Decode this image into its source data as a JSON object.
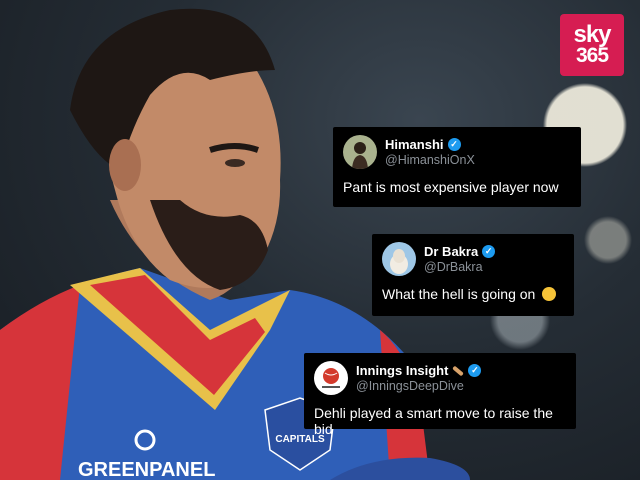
{
  "brand": {
    "logo_line1": "sky",
    "logo_line2": "365"
  },
  "jersey": {
    "sponsor": "GREENPANEL",
    "badge": "CAPITALS"
  },
  "tweets": [
    {
      "name": "Himanshi",
      "handle": "@HimanshiOnX",
      "text": "Pant is most expensive player now",
      "avatar_icon": "profile-photo-woman",
      "verified": true
    },
    {
      "name": "Dr Bakra",
      "handle": "@DrBakra",
      "text": "What the hell is going on",
      "avatar_icon": "goat-photo",
      "verified": true,
      "emoji": "crying-face-emoji"
    },
    {
      "name": "Innings Insight",
      "handle": "@InningsDeepDive",
      "text": "Dehli played a smart move to raise the bid",
      "avatar_icon": "cricket-ball-logo",
      "verified": true,
      "name_emoji": "cricket-bat-emoji"
    }
  ],
  "colors": {
    "logo_bg": "#d61d52",
    "tweet_bg": "#000000",
    "verified": "#1d9bf0",
    "jersey_blue": "#2f5fb8",
    "jersey_red": "#d6343a"
  }
}
